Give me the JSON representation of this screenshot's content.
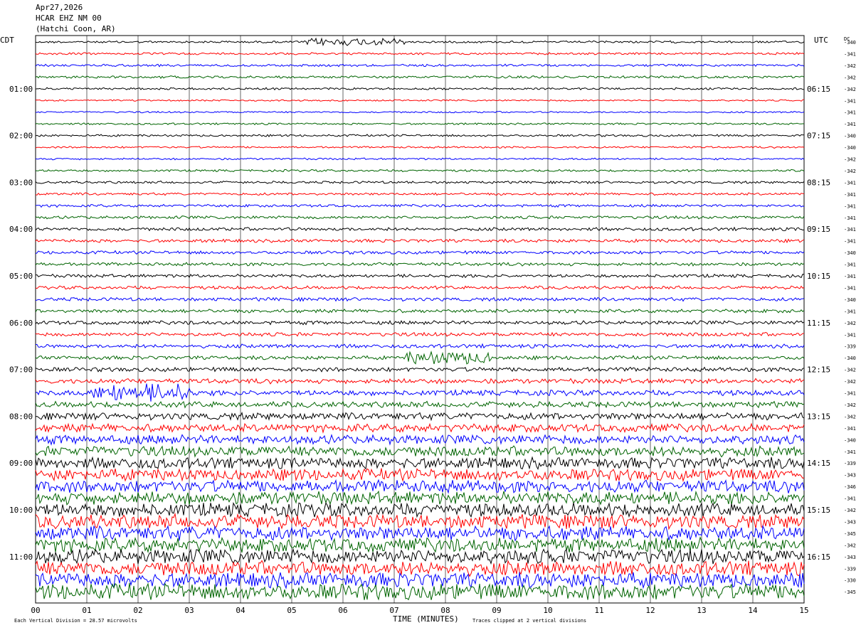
{
  "header": {
    "date": "Apr27,2026",
    "channel": "HCAR EHZ NM 00",
    "location": "(Hatchi Coon, AR)"
  },
  "axes": {
    "left_zone": "CDT",
    "right_zone": "UTC",
    "dc_label": "DC",
    "xlabel": "TIME (MINUTES)"
  },
  "footer": {
    "scale_text": "Each Vertical Division =   28.57 microvolts",
    "clip_text": "Traces clipped at 2 vertical divisions"
  },
  "chart_data": {
    "type": "line",
    "title": "HCAR EHZ NM 00",
    "x_range": [
      0,
      15
    ],
    "x_ticks": [
      "00",
      "01",
      "02",
      "03",
      "04",
      "05",
      "06",
      "07",
      "08",
      "09",
      "10",
      "11",
      "12",
      "13",
      "14",
      "15"
    ],
    "trace_count": 48,
    "trace_colors": [
      "#000000",
      "#ff0000",
      "#0000ff",
      "#006400"
    ],
    "left_time_labels": [
      "01:00",
      "02:00",
      "03:00",
      "04:00",
      "05:00",
      "06:00",
      "07:00",
      "08:00",
      "09:00",
      "10:00",
      "11:00"
    ],
    "right_time_labels": [
      "06:15",
      "07:15",
      "08:15",
      "09:15",
      "10:15",
      "11:15",
      "12:15",
      "13:15",
      "14:15",
      "15:15",
      "16:15"
    ],
    "dc_offsets": [
      -340,
      -341,
      -342,
      -342,
      -342,
      -341,
      -341,
      -341,
      -340,
      -340,
      -342,
      -342,
      -341,
      -341,
      -341,
      -341,
      -341,
      -341,
      -340,
      -341,
      -341,
      -341,
      -340,
      -341,
      -342,
      -341,
      -339,
      -340,
      -342,
      -342,
      -341,
      -342,
      -342,
      -341,
      -340,
      -341,
      -339,
      -343,
      -346,
      -341,
      -342,
      -343,
      -345,
      -342,
      -343,
      -339,
      -330,
      -345
    ],
    "amplitude_level": [
      0.4,
      0.4,
      0.45,
      0.45,
      0.4,
      0.3,
      0.3,
      0.35,
      0.4,
      0.35,
      0.35,
      0.4,
      0.45,
      0.45,
      0.5,
      0.55,
      0.6,
      0.6,
      0.6,
      0.6,
      0.6,
      0.6,
      0.65,
      0.65,
      0.7,
      0.7,
      0.7,
      0.7,
      0.8,
      0.9,
      1.0,
      1.1,
      1.3,
      1.5,
      1.7,
      1.9,
      2.1,
      2.2,
      2.3,
      2.4,
      2.5,
      2.6,
      2.6,
      2.6,
      2.7,
      2.7,
      2.8,
      3.0
    ]
  }
}
